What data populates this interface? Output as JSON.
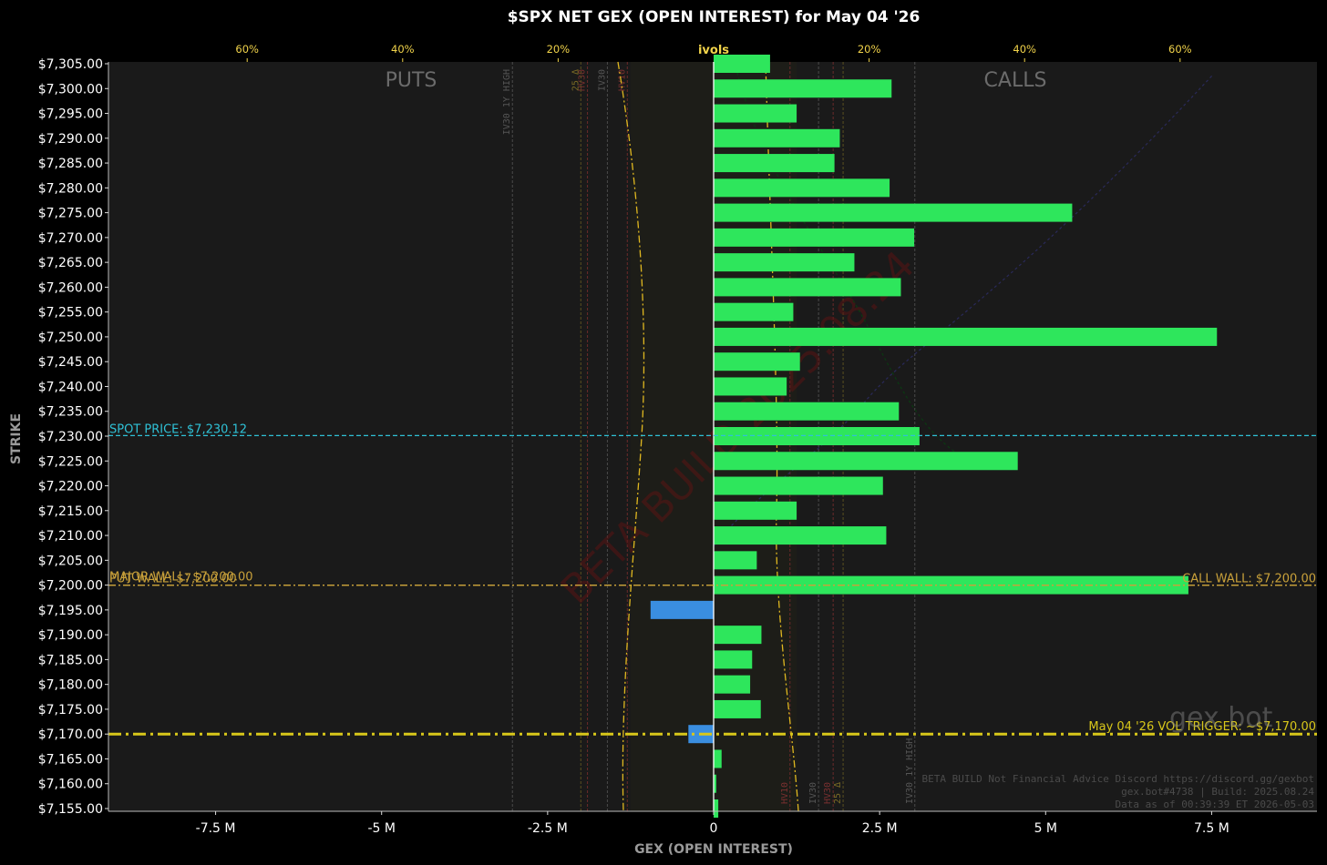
{
  "chart_data": {
    "type": "bar",
    "orientation": "horizontal",
    "title": "$SPX NET GEX (OPEN INTEREST) for May 04 '26",
    "xlabel": "GEX (OPEN INTEREST)",
    "ylabel": "STRIKE",
    "xlim": [
      -9100000,
      9100000
    ],
    "x_ticks": [
      {
        "value": -7500000,
        "label": "-7.5 M"
      },
      {
        "value": -5000000,
        "label": "-5 M"
      },
      {
        "value": -2500000,
        "label": "-2.5 M"
      },
      {
        "value": 0,
        "label": "0"
      },
      {
        "value": 2500000,
        "label": "2.5 M"
      },
      {
        "value": 5000000,
        "label": "5 M"
      },
      {
        "value": 7500000,
        "label": "7.5 M"
      }
    ],
    "top_axis": {
      "label": "ivols",
      "ticks": [
        {
          "value": -60,
          "label": "60%"
        },
        {
          "value": -40,
          "label": "40%"
        },
        {
          "value": -20,
          "label": "20%"
        },
        {
          "value": 20,
          "label": "20%"
        },
        {
          "value": 40,
          "label": "40%"
        },
        {
          "value": 60,
          "label": "60%"
        }
      ]
    },
    "side_labels": {
      "left": "PUTS",
      "right": "CALLS"
    },
    "colors": {
      "positive": "#2ee65c",
      "negative": "#3a8ee0",
      "spot": "#2fc1d6",
      "walls": "#c9a13a",
      "vol_trigger": "#d8c71a",
      "ivol": "#e0b820"
    },
    "strikes": [
      7305,
      7300,
      7295,
      7290,
      7285,
      7280,
      7275,
      7270,
      7265,
      7260,
      7255,
      7250,
      7245,
      7240,
      7235,
      7230,
      7225,
      7220,
      7215,
      7210,
      7205,
      7200,
      7195,
      7190,
      7185,
      7180,
      7175,
      7170,
      7165,
      7160,
      7155
    ],
    "strike_labels": [
      "$7,305.00",
      "$7,300.00",
      "$7,295.00",
      "$7,290.00",
      "$7,285.00",
      "$7,280.00",
      "$7,275.00",
      "$7,270.00",
      "$7,265.00",
      "$7,260.00",
      "$7,255.00",
      "$7,250.00",
      "$7,245.00",
      "$7,240.00",
      "$7,235.00",
      "$7,230.00",
      "$7,225.00",
      "$7,220.00",
      "$7,215.00",
      "$7,210.00",
      "$7,205.00",
      "$7,200.00",
      "$7,195.00",
      "$7,190.00",
      "$7,185.00",
      "$7,180.00",
      "$7,175.00",
      "$7,170.00",
      "$7,165.00",
      "$7,160.00",
      "$7,155.00"
    ],
    "values": [
      850000,
      2680000,
      1250000,
      1900000,
      1820000,
      2650000,
      5400000,
      3020000,
      2120000,
      2820000,
      1200000,
      7580000,
      1300000,
      1100000,
      2790000,
      3100000,
      4580000,
      2550000,
      1250000,
      2600000,
      650000,
      7150000,
      -950000,
      720000,
      580000,
      550000,
      710000,
      -380000,
      120000,
      40000,
      70000
    ],
    "levels": [
      {
        "label": "SPOT PRICE: $7,230.12",
        "strike": 7230.12
      },
      {
        "label": "PUT WALL: $7,200.00",
        "strike": 7200
      },
      {
        "label": "MAJOR WALL: $7,200.00",
        "strike": 7200
      },
      {
        "label": "CALL WALL: $7,200.00",
        "strike": 7200
      },
      {
        "label": "May 04 '26 VOL TRIGGER: ~$7,170.00",
        "strike": 7170
      }
    ],
    "vertical_markers": [
      {
        "label": "IV30 1Y HIGH",
        "x": -3030000,
        "side": "put"
      },
      {
        "label": "HV30",
        "x": -1900000,
        "side": "put"
      },
      {
        "label": "IV30",
        "x": -1600000,
        "side": "put"
      },
      {
        "label": "HV10",
        "x": -1300000,
        "side": "put"
      },
      {
        "label": "25 Δ",
        "x": -2000000,
        "side": "put"
      },
      {
        "label": "HV10",
        "x": 1150000,
        "side": "call"
      },
      {
        "label": "IV30",
        "x": 1580000,
        "side": "call"
      },
      {
        "label": "HV30",
        "x": 1800000,
        "side": "call"
      },
      {
        "label": "25 Δ",
        "x": 1950000,
        "side": "call"
      },
      {
        "label": "IV30 1Y HIGH",
        "x": 3030000,
        "side": "call"
      }
    ],
    "watermark": "BETA BUILD 2025.08.24",
    "logo": "gex bot",
    "footer": [
      "BETA BUILD Not Financial Advice Discord https://discord.gg/gexbot",
      "gex.bot#4738 | Build: 2025.08.24",
      "Data as of 00:39:39 ET 2026-05-03"
    ],
    "grid": false
  }
}
